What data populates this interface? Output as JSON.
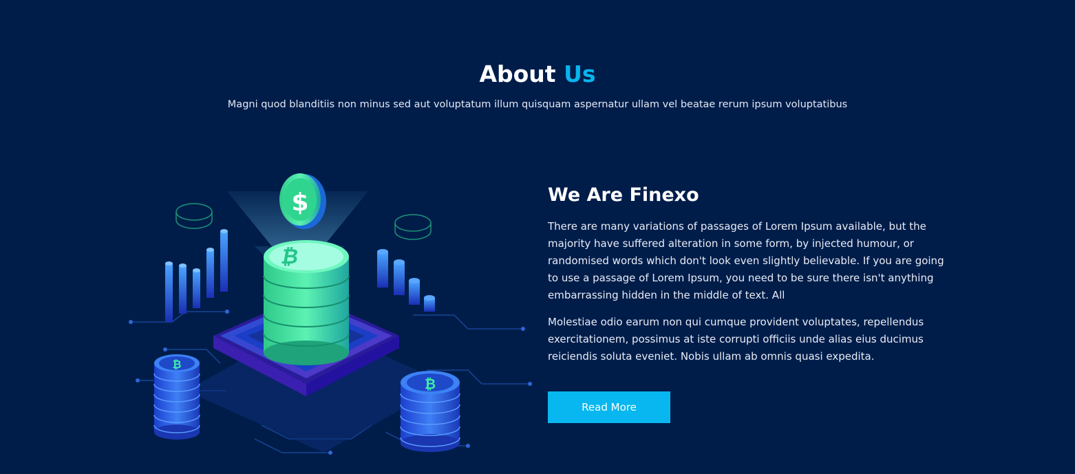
{
  "about": {
    "title_main": "About ",
    "title_accent": "Us",
    "subtitle": "Magni quod blanditiis non minus sed aut voluptatum illum quisquam aspernatur ullam vel beatae rerum ipsum voluptatibus"
  },
  "feature": {
    "heading": "We Are Finexo",
    "paragraph_1": "There are many variations of passages of Lorem Ipsum available, but the majority have suffered alteration in some form, by injected humour, or randomised words which don't look even slightly believable. If you are going to use a passage of Lorem Ipsum, you need to be sure there isn't anything embarrassing hidden in the middle of text. All",
    "paragraph_2": "Molestiae odio earum non qui cumque provident voluptates, repellendus exercitationem, possimus at iste corrupti officiis unde alias eius ducimus reiciendis soluta eveniet. Nobis ullam ab omnis quasi expedita.",
    "button_label": "Read More"
  },
  "colors": {
    "background": "#001d4a",
    "accent": "#08b4ee",
    "coin_green": "#33e39b",
    "coin_blue": "#2f6fe8"
  }
}
